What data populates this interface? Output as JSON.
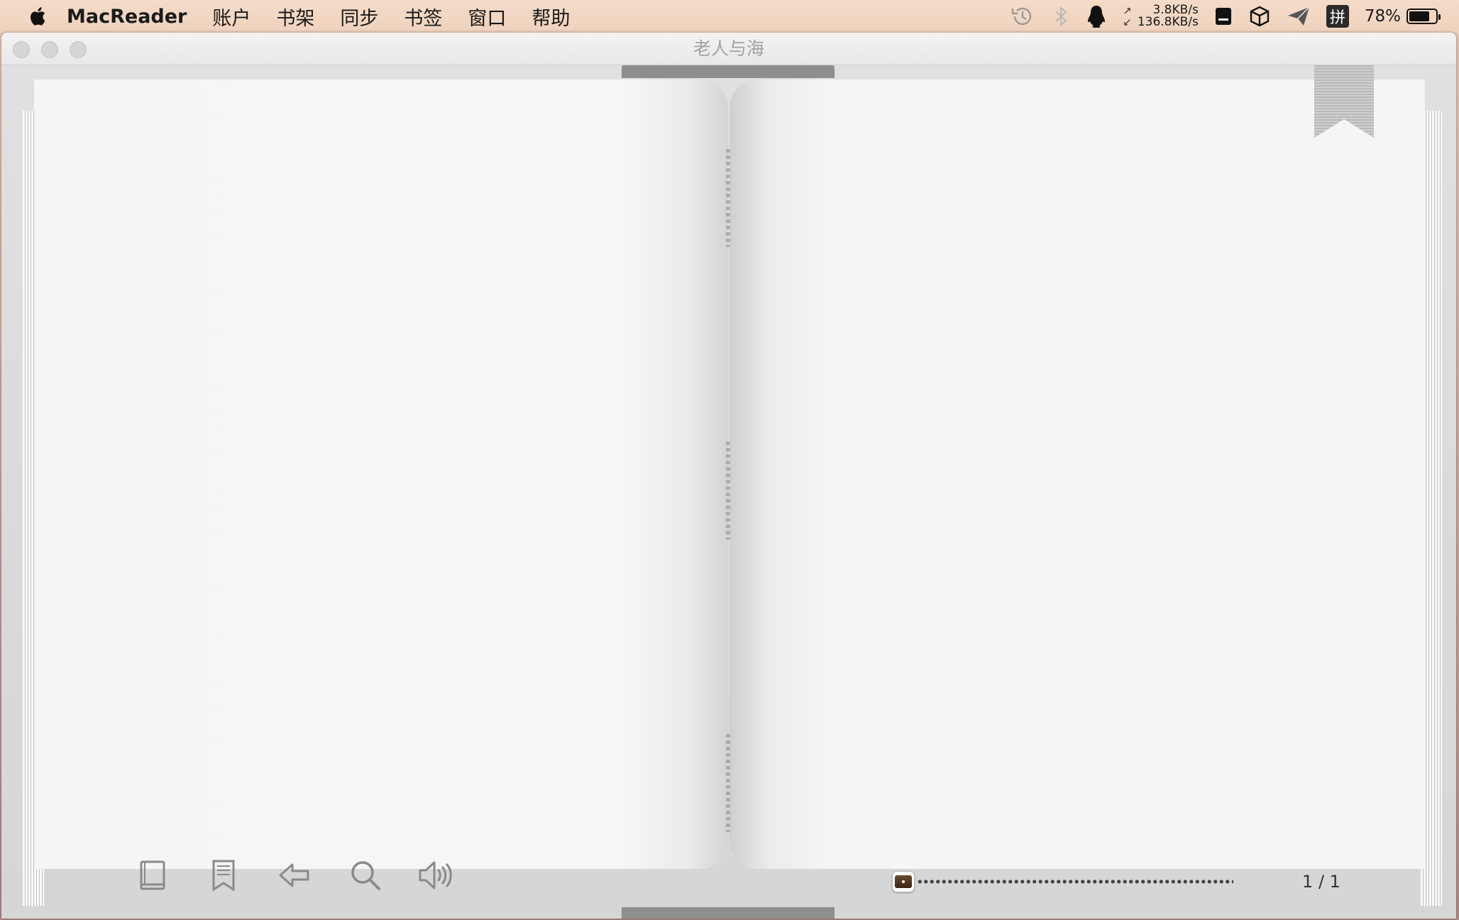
{
  "menubar": {
    "app_name": "MacReader",
    "menus": [
      "账户",
      "书架",
      "同步",
      "书签",
      "窗口",
      "帮助"
    ],
    "network": {
      "upload": "3.8KB/s",
      "download": "136.8KB/s",
      "up_arrow": "↗",
      "down_arrow": "↙"
    },
    "input_method": "拼",
    "battery_percent": "78%",
    "battery_level": 0.78
  },
  "window": {
    "title": "老人与海"
  },
  "reader": {
    "progress": {
      "position": 0.0
    },
    "page_indicator": "1 / 1",
    "toolbar_icons": [
      "library-icon",
      "bookmarks-icon",
      "back-icon",
      "search-icon",
      "speaker-icon"
    ]
  }
}
